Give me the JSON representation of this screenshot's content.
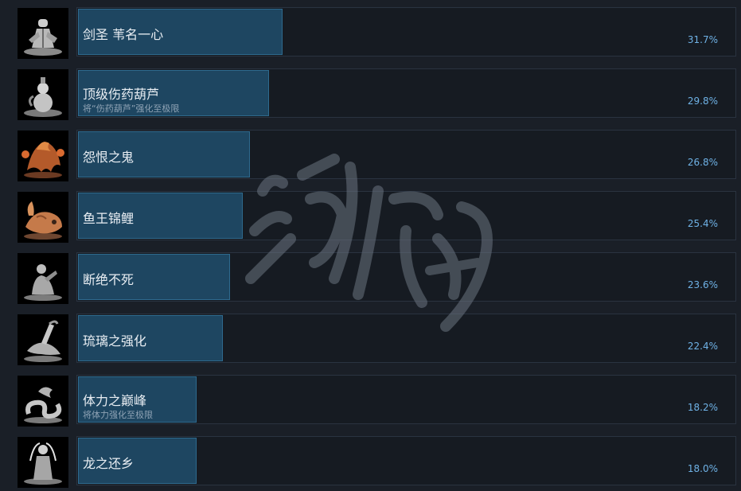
{
  "achievements": [
    {
      "title": "剑圣 苇名一心",
      "desc": "",
      "percent": "31.7%",
      "fill": 0.317,
      "icon": "samurai-statue-icon"
    },
    {
      "title": "顶级伤药葫芦",
      "desc": "将“伤药葫芦”强化至极限",
      "percent": "29.8%",
      "fill": 0.298,
      "icon": "gourd-icon"
    },
    {
      "title": "怨恨之鬼",
      "desc": "",
      "percent": "26.8%",
      "fill": 0.268,
      "icon": "flaming-demon-icon"
    },
    {
      "title": "鱼王锦鲤",
      "desc": "",
      "percent": "25.4%",
      "fill": 0.254,
      "icon": "carp-icon"
    },
    {
      "title": "断绝不死",
      "desc": "",
      "percent": "23.6%",
      "fill": 0.236,
      "icon": "kneeling-figure-icon"
    },
    {
      "title": "琉璃之强化",
      "desc": "",
      "percent": "22.4%",
      "fill": 0.224,
      "icon": "prosthetic-arm-icon"
    },
    {
      "title": "体力之巅峰",
      "desc": "将体力强化至极限",
      "percent": "18.2%",
      "fill": 0.182,
      "icon": "coiled-dragon-icon"
    },
    {
      "title": "龙之还乡",
      "desc": "",
      "percent": "18.0%",
      "fill": 0.18,
      "icon": "dragon-heir-icon"
    }
  ],
  "watermark": {
    "text": "游侠网"
  },
  "colors": {
    "bar_fill": "#1e4661",
    "percent_text": "#6fb2e6",
    "background": "#1a1f27"
  }
}
